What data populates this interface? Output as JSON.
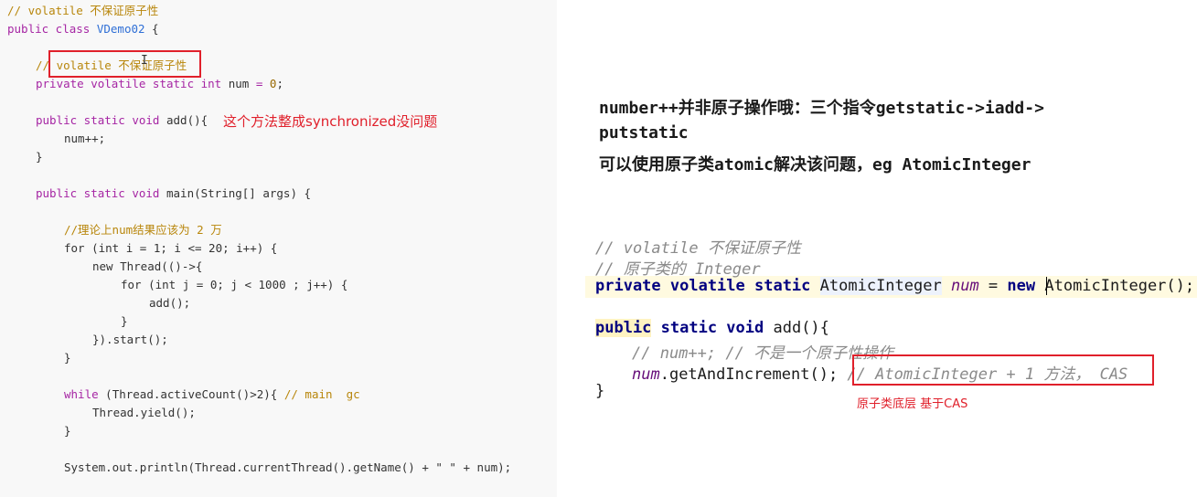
{
  "left_code": {
    "line1": "// volatile 不保证原子性",
    "line2_kw": "public class ",
    "line2_cls": "VDemo02",
    "line2_rest": " {",
    "line4_cm_slash": "// ",
    "line4_cm_text": "volatile 不保证原子性",
    "line5_kw": "private volatile static int",
    "line5_rest": " num ",
    "line5_eq": "=",
    "line5_num": " 0",
    "line5_end": ";",
    "line7_kw": "public static void",
    "line7_rest": " add(){",
    "line8": "num++;",
    "line9": "}",
    "line11_kw": "public static void",
    "line11_rest": " main(String[] args) {",
    "line13": "//理论上num结果应该为 2 万",
    "line14": "for (int i = 1; i <= 20; i++) {",
    "line15": "new Thread(()->{",
    "line16": "for (int j = 0; j < 1000 ; j++) {",
    "line17": "add();",
    "line18": "}",
    "line19": "}).start();",
    "line20": "}",
    "line22_kw": "while",
    "line22_rest": " (Thread.activeCount()>2){ ",
    "line22_cm": "// main  gc",
    "line23": "Thread.yield();",
    "line24": "}",
    "line26": "System.out.println(Thread.currentThread().getName() + \" \" + num);"
  },
  "left_annotation": "这个方法整成synchronized没问题",
  "right_notes": {
    "line1": "number++并非原子操作哦：三个指令getstatic->iadd->",
    "line2": "putstatic",
    "line3": "可以使用原子类atomic解决该问题，eg AtomicInteger"
  },
  "right_code": {
    "c1": "// volatile 不保证原子性",
    "c2": "// 原子类的 Integer",
    "c3_kw": "private volatile static",
    "c3_type": "AtomicInteger",
    "c3_field": "num",
    "c3_eq": " = ",
    "c3_new": "new",
    "c3_ctor": " AtomicInteger();",
    "c5_kw1": "public",
    "c5_kw2": " static void",
    "c5_rest": " add(){",
    "c6": "// num++; // 不是一个原子性操作",
    "c7_field": "num",
    "c7_rest": ".getAndIncrement(); ",
    "c7_cm": "// AtomicInteger + 1 方法， CAS",
    "c8": "}"
  },
  "cas_note": "原子类底层 基于CAS",
  "colors": {
    "accent_red": "#e0202b",
    "keyword": "#a626a4",
    "comment": "#b8860b",
    "class": "#2f6fd6"
  }
}
